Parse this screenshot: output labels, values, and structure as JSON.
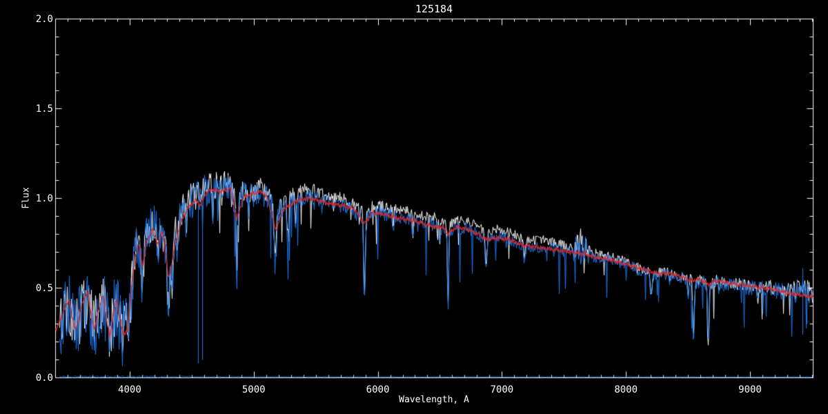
{
  "window": {
    "background": "#000000",
    "foreground": "#ffffff"
  },
  "chart_data": {
    "type": "line",
    "title": "125184",
    "xlabel": "Wavelength, A",
    "ylabel": "Flux",
    "xlim": [
      3400,
      9506
    ],
    "ylim": [
      0.0,
      2.0
    ],
    "grid": false,
    "legend": null,
    "axis_color": "#ffffff",
    "x_major_ticks": [
      4000,
      5000,
      6000,
      7000,
      8000,
      9000
    ],
    "x_tick_labels": [
      "4000",
      "5000",
      "6000",
      "7000",
      "8000",
      "9000"
    ],
    "x_minor_interval": 100,
    "y_major_ticks": [
      0.0,
      0.5,
      1.0,
      1.5,
      2.0
    ],
    "y_tick_labels": [
      "0.0",
      "0.5",
      "1.0",
      "1.5",
      "2.0"
    ],
    "y_minor_interval": 0.1,
    "colors": {
      "spectrum_blue": "#1b7af0",
      "observed_white": "#ffffff",
      "template_red": "#e02828"
    },
    "series": [
      {
        "name": "observed-white",
        "role": "observed spectrum (white, plotted beneath)",
        "color": "#ffffff",
        "line_width": 1,
        "x_start": 3434,
        "x_end": 9506,
        "continuum_ref": "spectrum-blue",
        "offset": [
          [
            3434,
            0.01
          ],
          [
            5100,
            0.02
          ],
          [
            5300,
            0.035
          ],
          [
            6200,
            0.04
          ],
          [
            7000,
            0.04
          ],
          [
            7600,
            0.03
          ],
          [
            8000,
            0.012
          ],
          [
            9506,
            0.008
          ]
        ],
        "lines_ref": "spectrum-blue",
        "noise_ref": "spectrum-blue",
        "noise_scale": 0.85,
        "noise_seed": 7,
        "spike_prob": 0.04,
        "spike_max": 0.22,
        "spike_min_wavelength": 4420
      },
      {
        "name": "spectrum-blue",
        "role": "main spectrum (blue)",
        "color": "#1b7af0",
        "line_width": 1,
        "x_start": 3434,
        "x_end": 9506,
        "continuum": [
          [
            3434,
            0.3
          ],
          [
            3470,
            0.35
          ],
          [
            3514,
            0.4
          ],
          [
            3560,
            0.26
          ],
          [
            3610,
            0.37
          ],
          [
            3660,
            0.42
          ],
          [
            3690,
            0.34
          ],
          [
            3717,
            0.27
          ],
          [
            3755,
            0.38
          ],
          [
            3783,
            0.42
          ],
          [
            3815,
            0.32
          ],
          [
            3839,
            0.25
          ],
          [
            3872,
            0.37
          ],
          [
            3895,
            0.4
          ],
          [
            3935,
            0.24
          ],
          [
            3968,
            0.27
          ],
          [
            3998,
            0.36
          ],
          [
            4030,
            0.62
          ],
          [
            4060,
            0.76
          ],
          [
            4100,
            0.68
          ],
          [
            4140,
            0.8
          ],
          [
            4190,
            0.85
          ],
          [
            4245,
            0.82
          ],
          [
            4310,
            0.62
          ],
          [
            4365,
            0.8
          ],
          [
            4425,
            0.92
          ],
          [
            4480,
            0.98
          ],
          [
            4540,
            1.0
          ],
          [
            4600,
            1.04
          ],
          [
            4660,
            1.06
          ],
          [
            4720,
            1.05
          ],
          [
            4790,
            1.07
          ],
          [
            4861,
            0.95
          ],
          [
            4920,
            1.03
          ],
          [
            4990,
            1.02
          ],
          [
            5060,
            1.04
          ],
          [
            5120,
            1.0
          ],
          [
            5180,
            0.92
          ],
          [
            5250,
            0.96
          ],
          [
            5330,
            0.99
          ],
          [
            5410,
            1.01
          ],
          [
            5480,
            1.01
          ],
          [
            5560,
            0.99
          ],
          [
            5660,
            0.97
          ],
          [
            5760,
            0.95
          ],
          [
            5890,
            0.88
          ],
          [
            5970,
            0.93
          ],
          [
            6060,
            0.91
          ],
          [
            6160,
            0.9
          ],
          [
            6260,
            0.88
          ],
          [
            6360,
            0.87
          ],
          [
            6460,
            0.85
          ],
          [
            6563,
            0.81
          ],
          [
            6660,
            0.84
          ],
          [
            6760,
            0.82
          ],
          [
            6870,
            0.77
          ],
          [
            6960,
            0.79
          ],
          [
            7060,
            0.77
          ],
          [
            7160,
            0.74
          ],
          [
            7260,
            0.73
          ],
          [
            7360,
            0.73
          ],
          [
            7460,
            0.71
          ],
          [
            7560,
            0.7
          ],
          [
            7630,
            0.72
          ],
          [
            7710,
            0.68
          ],
          [
            7810,
            0.66
          ],
          [
            7910,
            0.65
          ],
          [
            8010,
            0.63
          ],
          [
            8110,
            0.6
          ],
          [
            8210,
            0.57
          ],
          [
            8310,
            0.58
          ],
          [
            8410,
            0.56
          ],
          [
            8500,
            0.55
          ],
          [
            8545,
            0.52
          ],
          [
            8605,
            0.54
          ],
          [
            8665,
            0.51
          ],
          [
            8725,
            0.53
          ],
          [
            8810,
            0.52
          ],
          [
            8910,
            0.51
          ],
          [
            9010,
            0.5
          ],
          [
            9110,
            0.5
          ],
          [
            9210,
            0.49
          ],
          [
            9310,
            0.48
          ],
          [
            9410,
            0.48
          ],
          [
            9506,
            0.47
          ]
        ],
        "lines": [
          [
            4101,
            0.2,
            8
          ],
          [
            4227,
            0.22,
            6
          ],
          [
            4310,
            0.25,
            10
          ],
          [
            4340,
            0.2,
            7
          ],
          [
            4383,
            0.18,
            5
          ],
          [
            4455,
            0.12,
            4
          ],
          [
            4668,
            0.15,
            5
          ],
          [
            4861,
            0.45,
            5
          ],
          [
            4957,
            0.12,
            4
          ],
          [
            5170,
            0.3,
            10
          ],
          [
            5270,
            0.22,
            6
          ],
          [
            5335,
            0.18,
            5
          ],
          [
            5890,
            0.45,
            7
          ],
          [
            6122,
            0.12,
            4
          ],
          [
            6280,
            0.12,
            4
          ],
          [
            6495,
            0.12,
            5
          ],
          [
            6563,
            0.45,
            5
          ],
          [
            6870,
            0.17,
            8
          ],
          [
            7180,
            0.1,
            7
          ],
          [
            8200,
            0.1,
            9
          ],
          [
            8350,
            0.07,
            4
          ],
          [
            8498,
            0.12,
            5
          ],
          [
            8542,
            0.33,
            6
          ],
          [
            8662,
            0.33,
            6
          ],
          [
            8750,
            0.06,
            4
          ],
          [
            9061,
            0.06,
            4
          ]
        ],
        "noise_sigma": [
          [
            3400,
            0.19
          ],
          [
            3980,
            0.19
          ],
          [
            4030,
            0.13
          ],
          [
            4450,
            0.1
          ],
          [
            4750,
            0.085
          ],
          [
            5150,
            0.065
          ],
          [
            5350,
            0.045
          ],
          [
            5900,
            0.04
          ],
          [
            6400,
            0.036
          ],
          [
            7000,
            0.032
          ],
          [
            7560,
            0.035
          ],
          [
            7590,
            0.1
          ],
          [
            7670,
            0.1
          ],
          [
            7705,
            0.032
          ],
          [
            8300,
            0.033
          ],
          [
            8700,
            0.04
          ],
          [
            9100,
            0.045
          ],
          [
            9280,
            0.055
          ],
          [
            9400,
            0.07
          ],
          [
            9506,
            0.075
          ]
        ],
        "noise_seed": 11,
        "spike_prob": 0.05,
        "spike_max": 0.28,
        "spike_min_wavelength": 4420,
        "spikes": [
          [
            4549,
            0.08,
            0.98
          ],
          [
            4585,
            0.1,
            0.96
          ],
          [
            9424,
            0.24,
            0.61
          ],
          [
            9457,
            0.3,
            0.5
          ]
        ]
      },
      {
        "name": "template-fit-red",
        "role": "smooth template fit (red, on top)",
        "color": "#e02828",
        "line_width": 1.3,
        "x_start": 3402,
        "x_end": 9506,
        "continuum": [
          [
            3402,
            0.27
          ],
          [
            3450,
            0.34
          ],
          [
            3480,
            0.4
          ],
          [
            3514,
            0.43
          ],
          [
            3545,
            0.3
          ],
          [
            3560,
            0.26
          ],
          [
            3585,
            0.33
          ],
          [
            3610,
            0.4
          ],
          [
            3640,
            0.46
          ],
          [
            3661,
            0.48
          ],
          [
            3690,
            0.33
          ],
          [
            3717,
            0.27
          ],
          [
            3745,
            0.38
          ],
          [
            3783,
            0.46
          ],
          [
            3810,
            0.33
          ],
          [
            3839,
            0.23
          ],
          [
            3865,
            0.35
          ],
          [
            3889,
            0.44
          ],
          [
            3915,
            0.34
          ],
          [
            3950,
            0.23
          ],
          [
            3980,
            0.27
          ],
          [
            4010,
            0.48
          ],
          [
            4040,
            0.67
          ],
          [
            4070,
            0.75
          ],
          [
            4101,
            0.62
          ],
          [
            4135,
            0.76
          ],
          [
            4180,
            0.83
          ],
          [
            4227,
            0.74
          ],
          [
            4265,
            0.82
          ],
          [
            4310,
            0.55
          ],
          [
            4340,
            0.65
          ],
          [
            4380,
            0.8
          ],
          [
            4430,
            0.9
          ],
          [
            4480,
            0.96
          ],
          [
            4530,
            0.99
          ],
          [
            4570,
            0.96
          ],
          [
            4610,
            1.03
          ],
          [
            4660,
            1.05
          ],
          [
            4710,
            1.04
          ],
          [
            4760,
            1.04
          ],
          [
            4810,
            1.06
          ],
          [
            4861,
            0.88
          ],
          [
            4910,
            1.0
          ],
          [
            4960,
            1.02
          ],
          [
            5010,
            1.03
          ],
          [
            5060,
            1.04
          ],
          [
            5110,
            1.0
          ],
          [
            5175,
            0.82
          ],
          [
            5235,
            0.94
          ],
          [
            5285,
            0.96
          ],
          [
            5355,
            0.99
          ],
          [
            5430,
            1.0
          ],
          [
            5510,
            0.99
          ],
          [
            5610,
            0.97
          ],
          [
            5710,
            0.96
          ],
          [
            5810,
            0.94
          ],
          [
            5890,
            0.86
          ],
          [
            5955,
            0.92
          ],
          [
            6060,
            0.91
          ],
          [
            6160,
            0.89
          ],
          [
            6260,
            0.88
          ],
          [
            6360,
            0.86
          ],
          [
            6460,
            0.84
          ],
          [
            6520,
            0.84
          ],
          [
            6563,
            0.8
          ],
          [
            6625,
            0.84
          ],
          [
            6710,
            0.83
          ],
          [
            6810,
            0.8
          ],
          [
            6870,
            0.77
          ],
          [
            6955,
            0.78
          ],
          [
            7060,
            0.77
          ],
          [
            7160,
            0.74
          ],
          [
            7260,
            0.73
          ],
          [
            7360,
            0.72
          ],
          [
            7460,
            0.71
          ],
          [
            7560,
            0.7
          ],
          [
            7660,
            0.69
          ],
          [
            7760,
            0.67
          ],
          [
            7860,
            0.66
          ],
          [
            7960,
            0.64
          ],
          [
            8060,
            0.62
          ],
          [
            8160,
            0.6
          ],
          [
            8260,
            0.58
          ],
          [
            8360,
            0.58
          ],
          [
            8460,
            0.56
          ],
          [
            8520,
            0.54
          ],
          [
            8585,
            0.55
          ],
          [
            8662,
            0.52
          ],
          [
            8725,
            0.54
          ],
          [
            8810,
            0.53
          ],
          [
            8910,
            0.52
          ],
          [
            9010,
            0.51
          ],
          [
            9110,
            0.5
          ],
          [
            9210,
            0.49
          ],
          [
            9310,
            0.47
          ],
          [
            9410,
            0.46
          ],
          [
            9506,
            0.45
          ]
        ],
        "wiggle": 0.008
      },
      {
        "name": "noise-floor-blue",
        "role": "noise/error spectrum along zero level (blue)",
        "color": "#1b7af0",
        "line_width": 1,
        "x_start": 3434,
        "x_end": 9506,
        "continuum": [
          [
            3434,
            0.006
          ],
          [
            9506,
            0.005
          ]
        ],
        "noise_sigma": [
          [
            3434,
            0.006
          ],
          [
            4500,
            0.004
          ],
          [
            4700,
            0.002
          ],
          [
            9506,
            0.002
          ]
        ],
        "noise_seed": 3
      }
    ]
  }
}
